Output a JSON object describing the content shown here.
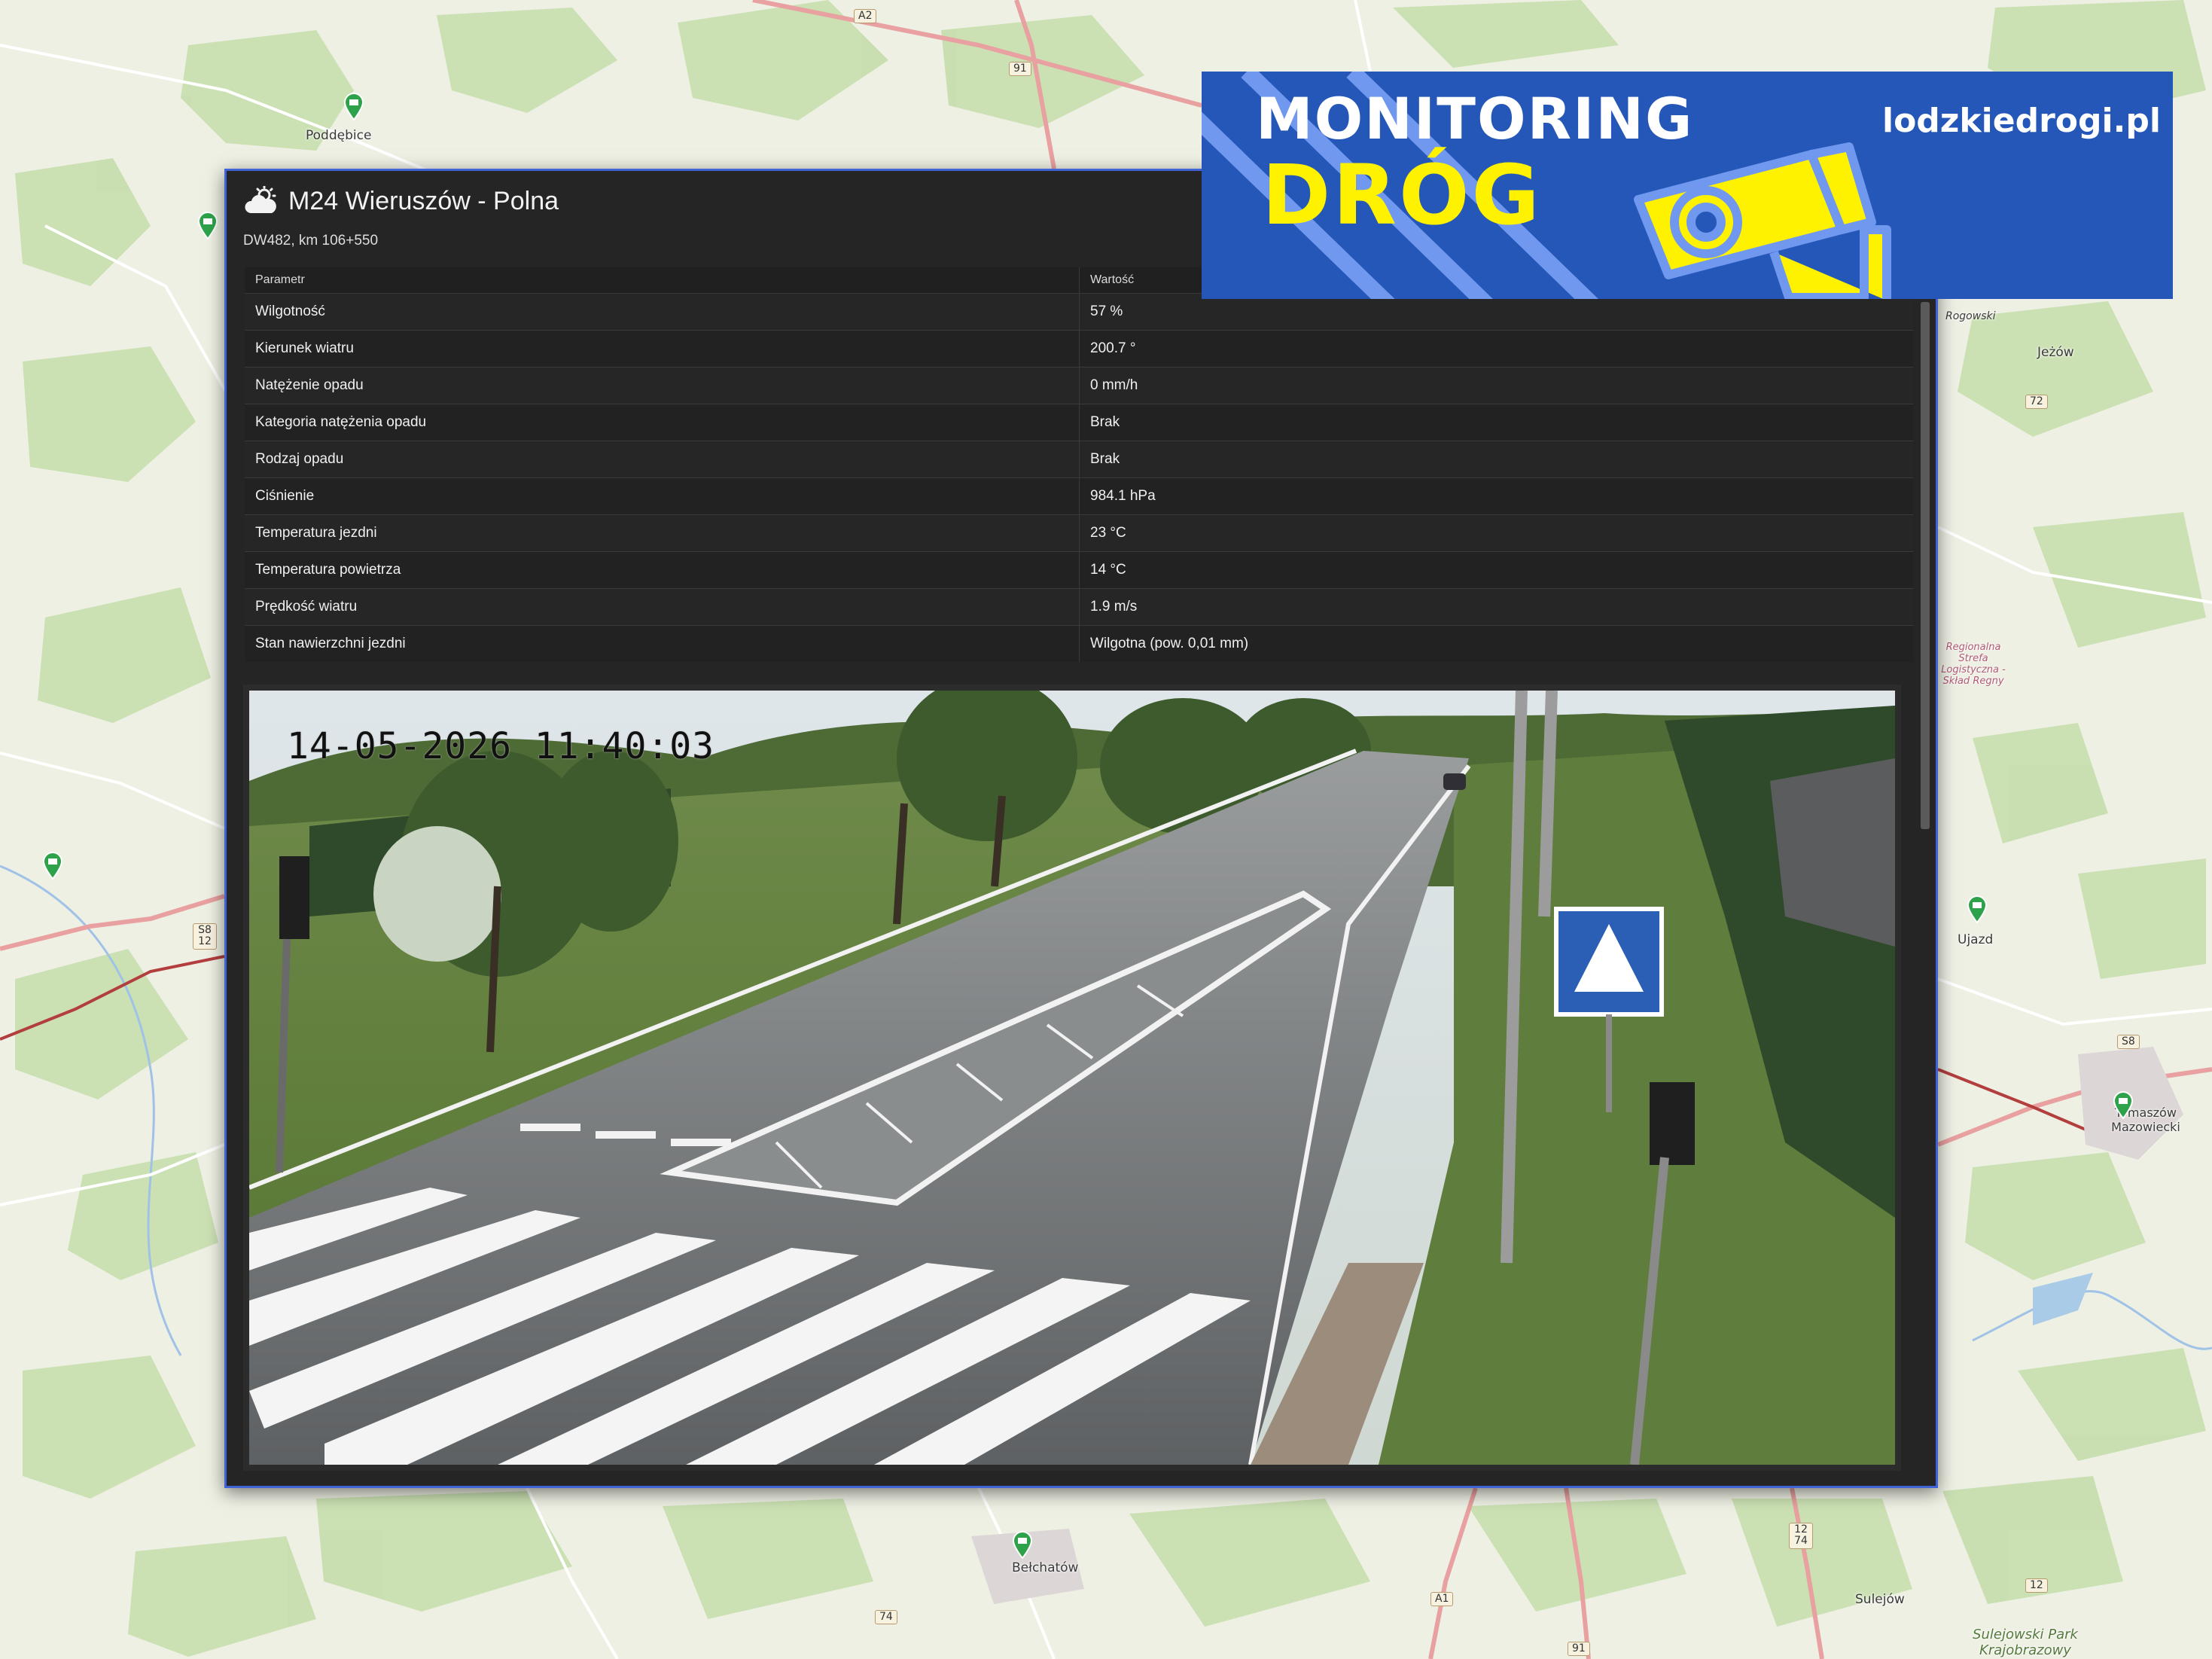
{
  "map": {
    "places": [
      {
        "name": "Poddębice"
      },
      {
        "name": "Jeżów"
      },
      {
        "name": "Ujazd"
      },
      {
        "name": "Tomaszów Mazowiecki"
      },
      {
        "name": "Bełchatów"
      },
      {
        "name": "Sulejów"
      },
      {
        "name": "Sulejowski Park Krajobrazowy"
      },
      {
        "name": "Regionalna Strefa Logistyczna - Skład Regny"
      },
      {
        "name": "Rogowski"
      }
    ],
    "road_numbers": [
      "A2",
      "91",
      "72",
      "S8 12",
      "S8",
      "A1",
      "74",
      "12 74",
      "12",
      "91"
    ]
  },
  "banner": {
    "title_line_1": "MONITORING",
    "title_line_2": "DRÓG",
    "site": "lodzkiedrogi.pl",
    "colors": {
      "background": "#2557b8",
      "accent": "#fff200"
    }
  },
  "panel": {
    "icon": "weather-cloud-sun-icon",
    "title": "M24 Wieruszów - Polna",
    "subtitle": "DW482, km 106+550",
    "table": {
      "headers": [
        "Parametr",
        "Wartość"
      ],
      "rows": [
        [
          "Wilgotność",
          "57 %"
        ],
        [
          "Kierunek wiatru",
          "200.7 °"
        ],
        [
          "Natężenie opadu",
          "0 mm/h"
        ],
        [
          "Kategoria natężenia opadu",
          "Brak"
        ],
        [
          "Rodzaj opadu",
          "Brak"
        ],
        [
          "Ciśnienie",
          "984.1 hPa"
        ],
        [
          "Temperatura jezdni",
          "23 °C"
        ],
        [
          "Temperatura powietrza",
          "14 °C"
        ],
        [
          "Prędkość wiatru",
          "1.9 m/s"
        ],
        [
          "Stan nawierzchni jezdni",
          "Wilgotna (pow. 0,01 mm)"
        ]
      ]
    },
    "camera": {
      "timestamp": "14-05-2026 11:40:03"
    },
    "colors": {
      "border": "#3f63d7",
      "background": "#252525"
    }
  }
}
